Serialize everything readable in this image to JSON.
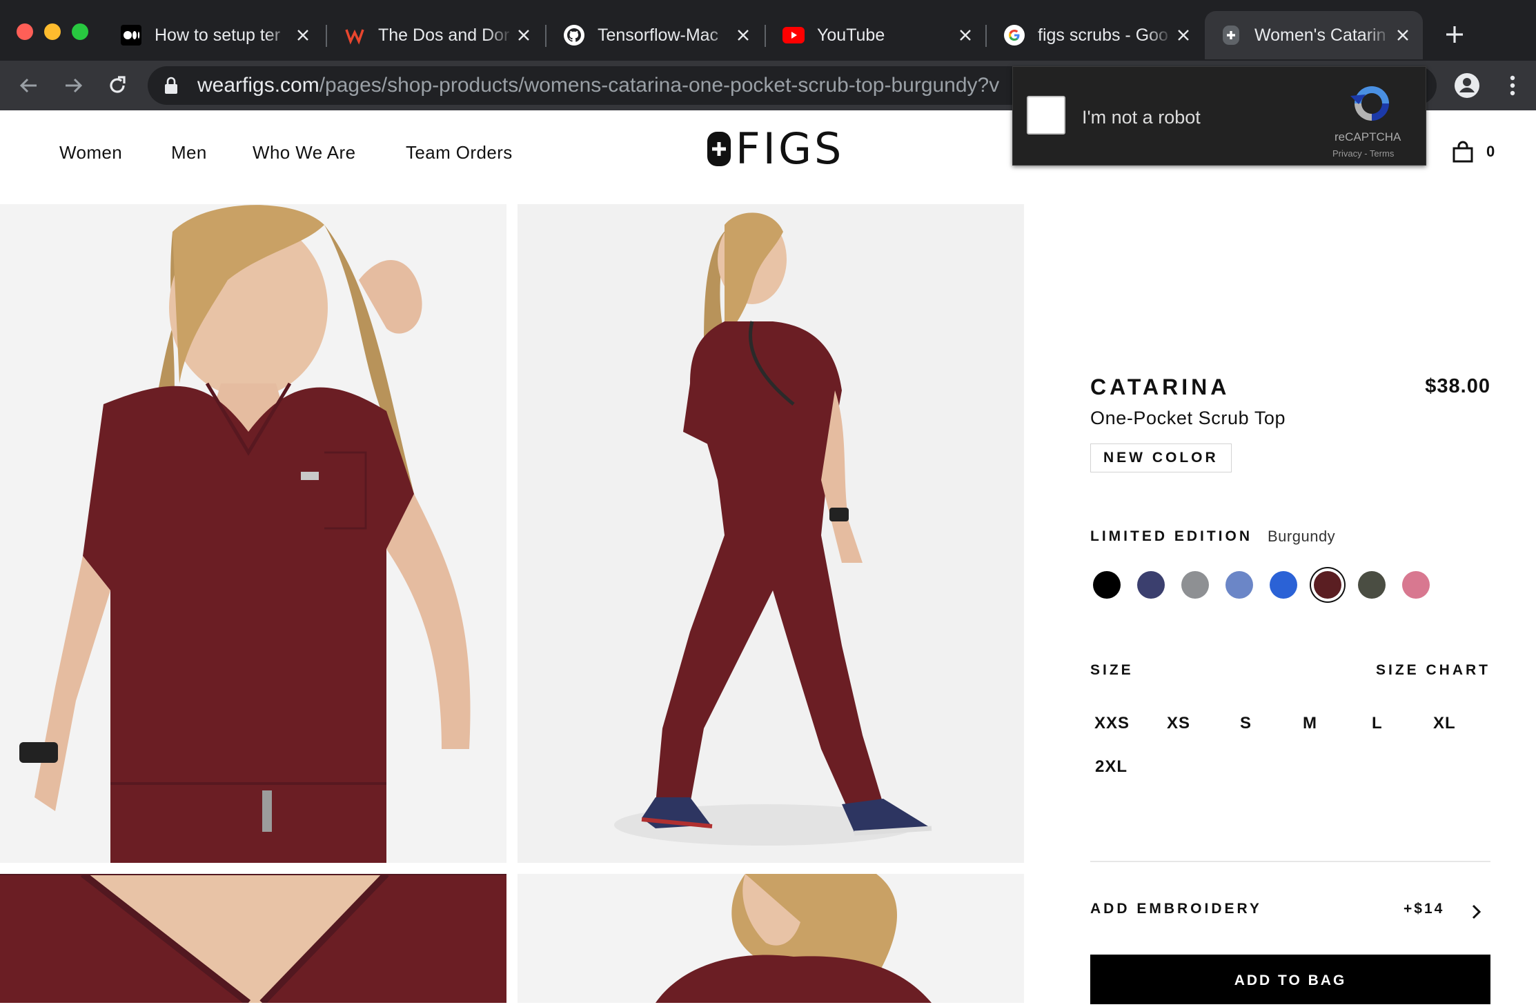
{
  "browser": {
    "tabs": [
      {
        "title": "How to setup ter",
        "favicon": "medium-icon"
      },
      {
        "title": "The Dos and Dor",
        "favicon": "w-logo-icon"
      },
      {
        "title": "Tensorflow-Mac",
        "favicon": "github-icon"
      },
      {
        "title": "YouTube",
        "favicon": "youtube-icon"
      },
      {
        "title": "figs scrubs - Goo",
        "favicon": "google-icon"
      },
      {
        "title": "Women's Catarin",
        "favicon": "figs-icon",
        "active": true
      }
    ],
    "url_host": "wearfigs.com",
    "url_path": "/pages/shop-products/womens-catarina-one-pocket-scrub-top-burgundy?v"
  },
  "recaptcha": {
    "label": "I'm not a robot",
    "brand": "reCAPTCHA",
    "links": "Privacy - Terms"
  },
  "site": {
    "nav": [
      "Women",
      "Men",
      "Who We Are",
      "Team Orders"
    ],
    "logo_text": "FIGS",
    "bag_count": "0"
  },
  "product": {
    "name": "CATARINA",
    "price": "$38.00",
    "subtitle": "One-Pocket Scrub Top",
    "badge": "NEW COLOR",
    "color_label": "LIMITED EDITION",
    "color_value": "Burgundy",
    "swatches": [
      "#000000",
      "#3b3f6e",
      "#8e9093",
      "#6b86c7",
      "#2b62d6",
      "#5a1e22",
      "#4a4d42",
      "#d87890"
    ],
    "selected_swatch": 5,
    "size_label": "SIZE",
    "size_chart": "SIZE CHART",
    "sizes": [
      "XXS",
      "XS",
      "S",
      "M",
      "L",
      "XL",
      "2XL"
    ],
    "embroidery_label": "ADD EMBROIDERY",
    "embroidery_price": "+$14",
    "add_to_bag": "ADD TO BAG"
  },
  "colors": {
    "burgundy": "#6b1e24",
    "chrome_dark": "#202124",
    "chrome_toolbar": "#35363a"
  }
}
